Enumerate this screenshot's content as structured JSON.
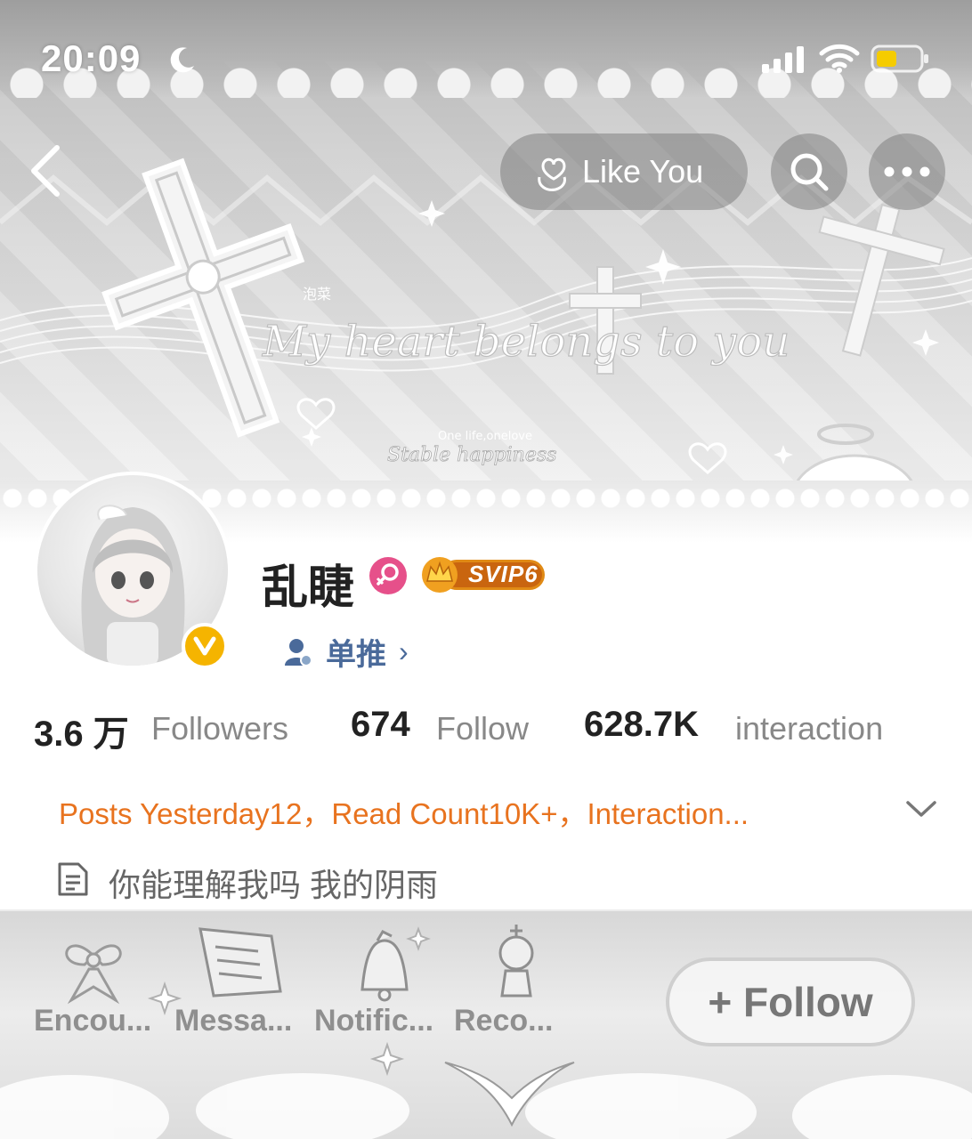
{
  "status_bar": {
    "time": "20:09"
  },
  "nav": {
    "like_label": "Like You"
  },
  "banner": {
    "script_text": "My heart belongs to you",
    "tagline": "Stable happiness",
    "small_text": "One life,onelove",
    "tag": "泡菜"
  },
  "profile": {
    "name": "乱睫",
    "svip": "SVIP6",
    "single_push": "单推"
  },
  "stats": {
    "followers_value": "3.6 万",
    "followers_label": "Followers",
    "follow_value": "674",
    "follow_label": "Follow",
    "interaction_value": "628.7K",
    "interaction_label": "interaction"
  },
  "summary": "Posts Yesterday12，Read Count10K+，Interaction...",
  "bio": "你能理解我吗 我的阴雨",
  "tabs": [
    {
      "label": "Encou..."
    },
    {
      "label": "Messa..."
    },
    {
      "label": "Notific..."
    },
    {
      "label": "Reco..."
    }
  ],
  "follow_button": "+ Follow",
  "colors": {
    "accent_orange": "#e8731f",
    "link_blue": "#4a6a9a",
    "verified_gold": "#f5b400",
    "gender_pink": "#e6508a"
  }
}
